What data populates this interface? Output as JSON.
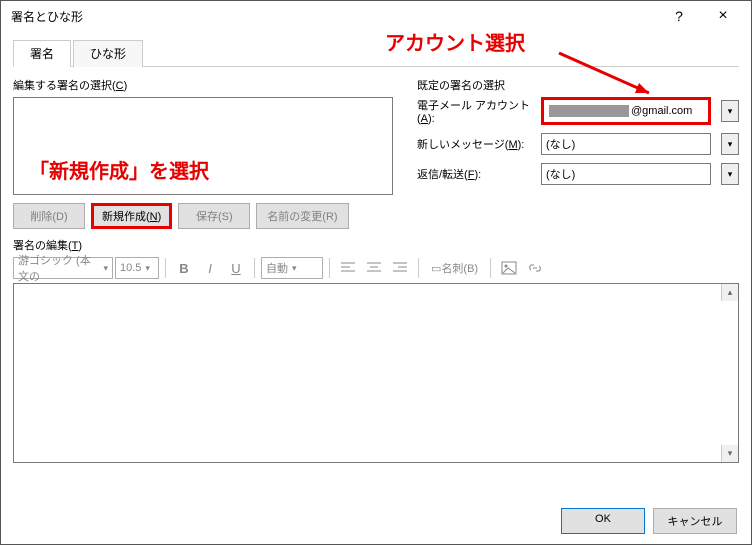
{
  "window": {
    "title": "署名とひな形",
    "help": "?",
    "close": "×"
  },
  "tabs": {
    "signature": "署名",
    "template": "ひな形"
  },
  "left": {
    "select_label_pre": "編集する署名の選択(",
    "select_label_key": "C",
    "select_label_post": ")",
    "btn_delete": "削除(D)",
    "btn_new_pre": "新規作成(",
    "btn_new_key": "N",
    "btn_new_post": ")",
    "btn_save": "保存(S)",
    "btn_rename": "名前の変更(R)"
  },
  "right": {
    "group_label": "既定の署名の選択",
    "account_label_pre": "電子メール アカウント(",
    "account_label_key": "A",
    "account_label_post": "):",
    "account_value_suffix": "@gmail.com",
    "newmsg_label_pre": "新しいメッセージ(",
    "newmsg_label_key": "M",
    "newmsg_label_post": "):",
    "newmsg_value": "(なし)",
    "reply_label_pre": "返信/転送(",
    "reply_label_key": "F",
    "reply_label_post": "):",
    "reply_value": "(なし)"
  },
  "editor": {
    "label_pre": "署名の編集(",
    "label_key": "T",
    "label_post": ")",
    "font": "游ゴシック (本文の",
    "size": "10.5",
    "auto": "自動",
    "bizcard": "名刺(B)"
  },
  "footer": {
    "ok": "OK",
    "cancel": "キャンセル"
  },
  "annot": {
    "account": "アカウント選択",
    "new": "「新規作成」を選択"
  }
}
